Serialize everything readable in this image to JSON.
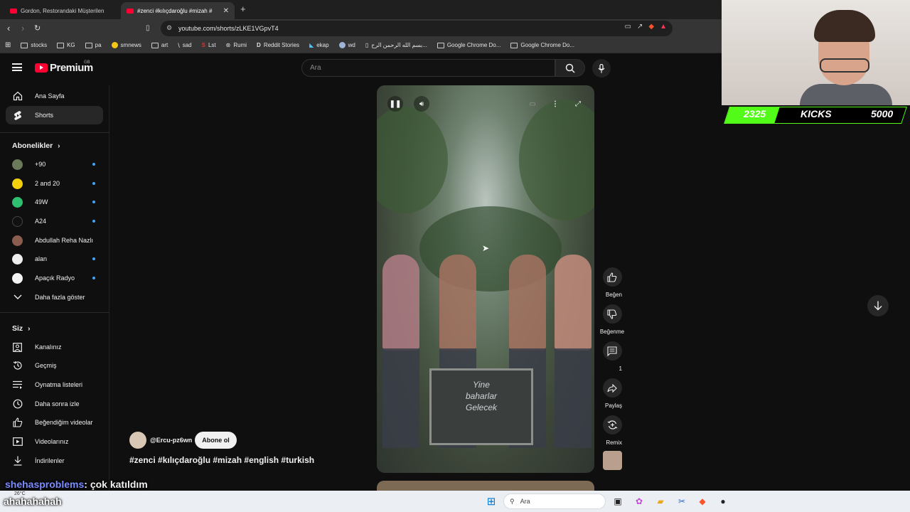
{
  "tabs": [
    {
      "label": "Gordon, Restorandaki Müşterilen"
    },
    {
      "label": "#zenci #kılıçdaroğlu #mizah #"
    }
  ],
  "address": {
    "url": "youtube.com/shorts/zLKE1VGpvT4"
  },
  "bookmarks": [
    "stocks",
    "KG",
    "pa",
    "smnews",
    "art",
    "sad",
    "Lst",
    "Rumi",
    "Reddit Stories",
    "ekap",
    "wd",
    "بسم الله الرحمن الرح...",
    "Google Chrome Do...",
    "Google Chrome Do..."
  ],
  "header": {
    "logo": "Premium",
    "region": "GB",
    "search_placeholder": "Ara"
  },
  "sidebar": {
    "main": [
      {
        "label": "Ana Sayfa",
        "icon": "home-icon"
      },
      {
        "label": "Shorts",
        "icon": "shorts-icon"
      }
    ],
    "subs_title": "Abonelikler",
    "subscriptions": [
      {
        "label": "+90",
        "color": "#6b7a5a"
      },
      {
        "label": "2 and 20",
        "color": "#f2d00c"
      },
      {
        "label": "49W",
        "color": "#2fbf71"
      },
      {
        "label": "A24",
        "color": "#111111"
      },
      {
        "label": "Abdullah Reha Nazlı",
        "color": "#8a5d4e"
      },
      {
        "label": "alan",
        "color": "#eeeeee"
      },
      {
        "label": "Apaçık Radyo",
        "color": "#f4f4f4"
      }
    ],
    "show_more": "Daha fazla göster",
    "you_title": "Siz",
    "you": [
      {
        "label": "Kanalınız",
        "icon": "channel-icon"
      },
      {
        "label": "Geçmiş",
        "icon": "history-icon"
      },
      {
        "label": "Oynatma listeleri",
        "icon": "playlist-icon"
      },
      {
        "label": "Daha sonra izle",
        "icon": "clock-icon"
      },
      {
        "label": "Beğendiğim videolar",
        "icon": "like-icon"
      },
      {
        "label": "Videolarınız",
        "icon": "video-icon"
      },
      {
        "label": "İndirilenler",
        "icon": "download-icon"
      }
    ]
  },
  "video": {
    "sign_lines": [
      "Yine",
      "baharlar",
      "Gelecek"
    ],
    "channel": "@Ercu-pz6wn",
    "subscribe": "Abone ol",
    "hashtags": "#zenci #kılıçdaroğlu #mizah #english #turkish"
  },
  "actions": {
    "like": "Beğen",
    "dislike": "Beğenme",
    "comments": "1",
    "share": "Paylaş",
    "remix": "Remix"
  },
  "overlay": {
    "kicks_count": "2325",
    "kicks_label": "KICKS",
    "kicks_goal": "5000",
    "chat_user": "shehasproblems",
    "chat_message": ": çok katıldım",
    "chat_line2": "ahahahahah",
    "weather": "26°C"
  },
  "taskbar": {
    "search": "Ara"
  }
}
